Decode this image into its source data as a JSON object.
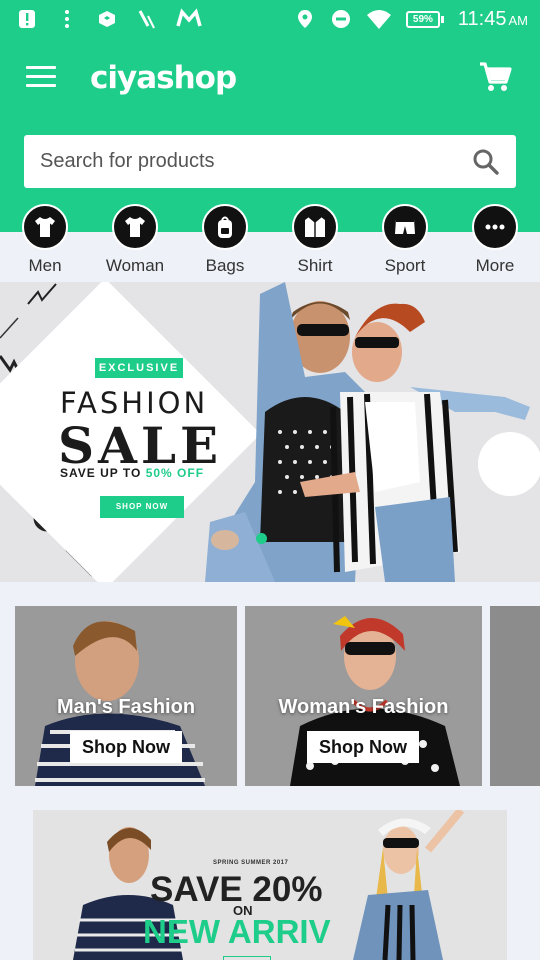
{
  "status_bar": {
    "battery": "59%",
    "time": "11:45",
    "ampm": "AM"
  },
  "header": {
    "logo_text": "ciyashop",
    "search_placeholder": "Search for products"
  },
  "categories": [
    {
      "label": "Men",
      "icon": "tshirt-icon"
    },
    {
      "label": "Woman",
      "icon": "tshirt-icon"
    },
    {
      "label": "Bags",
      "icon": "backpack-icon"
    },
    {
      "label": "Shirt",
      "icon": "shirt-icon"
    },
    {
      "label": "Sport",
      "icon": "shorts-icon"
    },
    {
      "label": "More",
      "icon": "more-dots-icon"
    }
  ],
  "hero": {
    "badge": "EXCLUSIVE",
    "line1": "FASHION",
    "line2": "SALE",
    "save_prefix": "SAVE UP TO ",
    "save_highlight": "50% OFF",
    "button": "SHOP NOW"
  },
  "promos": [
    {
      "title": "Man's Fashion",
      "button": "Shop Now"
    },
    {
      "title": "Woman's Fashion",
      "button": "Shop Now"
    }
  ],
  "banner2": {
    "small": "SPRING SUMMER 2017",
    "save": "SAVE 20%",
    "on": "ON",
    "new": "NEW ARRIV"
  },
  "colors": {
    "brand": "#1fcd8a",
    "background": "#eef2f8"
  }
}
